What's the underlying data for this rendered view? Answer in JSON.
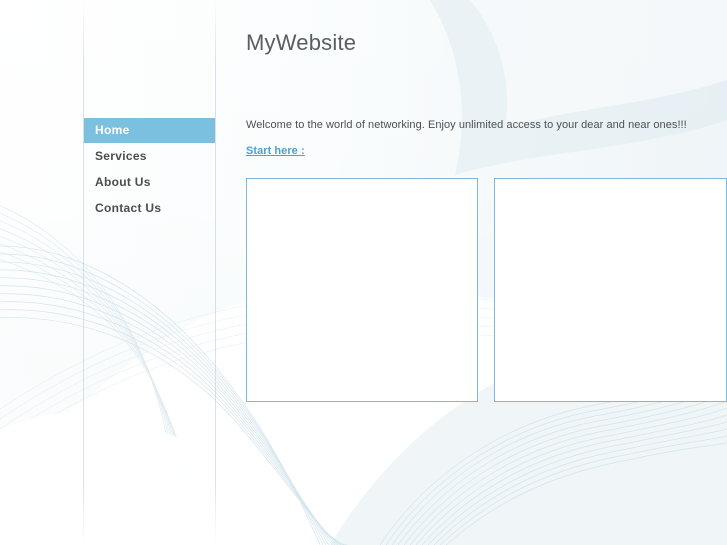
{
  "site": {
    "title": "MyWebsite"
  },
  "nav": {
    "items": [
      {
        "label": "Home",
        "active": true
      },
      {
        "label": "Services",
        "active": false
      },
      {
        "label": "About Us",
        "active": false
      },
      {
        "label": "Contact Us",
        "active": false
      }
    ]
  },
  "content": {
    "intro": "Welcome to the world of networking. Enjoy unlimited access to your dear and near ones!!!",
    "start_link": "Start here :"
  },
  "media": {
    "boxes": [
      {
        "name": "image-placeholder-1"
      },
      {
        "name": "image-placeholder-2"
      }
    ]
  },
  "colors": {
    "nav_active_bg": "#7cc0e0",
    "link": "#4f9fd0",
    "box_border": "#7fb8dd",
    "title_text": "#5b5e61",
    "body_text": "#4d5053",
    "page_bg": "#ffffff"
  }
}
